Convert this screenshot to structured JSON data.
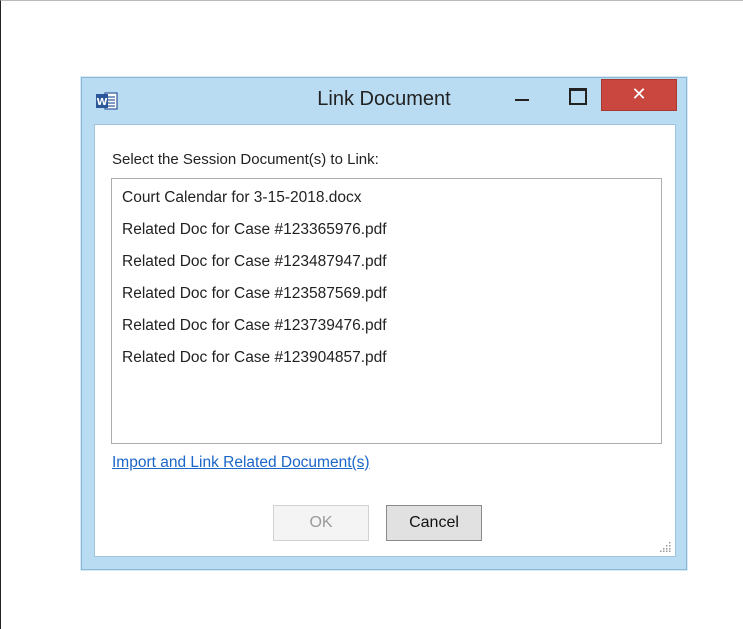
{
  "window": {
    "title": "Link Document",
    "app_icon": "word-icon",
    "close_glyph": "✕"
  },
  "dialog": {
    "prompt": "Select the Session Document(s) to Link:",
    "items": [
      "Court Calendar for 3-15-2018.docx",
      "Related Doc for Case #123365976.pdf",
      "Related Doc for Case #123487947.pdf",
      "Related Doc for Case #123587569.pdf",
      "Related Doc for Case #123739476.pdf",
      "Related Doc for Case #123904857.pdf"
    ],
    "import_link": "Import and Link Related Document(s)",
    "ok_label": "OK",
    "cancel_label": "Cancel"
  },
  "colors": {
    "frame": "#b9dcf3",
    "close_button": "#c9473f",
    "link": "#1b66c9",
    "word_blue": "#2b579a"
  }
}
